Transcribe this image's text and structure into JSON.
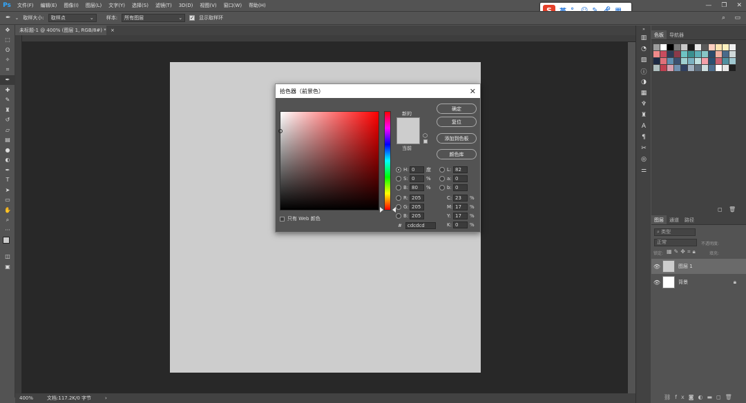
{
  "menubar": {
    "logo": "Ps",
    "items": [
      "文件(F)",
      "编辑(E)",
      "图像(I)",
      "图层(L)",
      "文字(Y)",
      "选择(S)",
      "滤镜(T)",
      "3D(D)",
      "视图(V)",
      "窗口(W)",
      "帮助(H)"
    ]
  },
  "ime": {
    "lang": "英"
  },
  "options": {
    "sample_size_label": "取样大小:",
    "sample_size_value": "取样点",
    "sample_label": "样本:",
    "sample_value": "所有图层",
    "show_ring_label": "显示取样环"
  },
  "document": {
    "tab_title": "未标题-1 @ 400% (图层 1, RGB/8#) *",
    "canvas_color": "#cdcdcd",
    "zoom": "400%",
    "doc_size": "文档:117.2K/0 字节"
  },
  "picker": {
    "title": "拾色器（前景色）",
    "new_label": "新的",
    "current_label": "当前",
    "buttons": {
      "ok": "确定",
      "reset": "复位",
      "add_to_swatches": "添加到色板",
      "color_libraries": "颜色库"
    },
    "hsb": {
      "h_label": "H:",
      "h": "0",
      "h_unit": "度",
      "s_label": "S:",
      "s": "0",
      "s_unit": "%",
      "b_label": "B:",
      "b": "80",
      "b_unit": "%"
    },
    "rgb": {
      "r_label": "R:",
      "r": "205",
      "g_label": "G:",
      "g": "205",
      "b_label": "B:",
      "b": "205"
    },
    "lab": {
      "l_label": "L:",
      "l": "82",
      "a_label": "a:",
      "a": "0",
      "b_label": "b:",
      "b": "0"
    },
    "cmyk": {
      "c_label": "C:",
      "c": "23",
      "c_unit": "%",
      "m_label": "M:",
      "m": "17",
      "m_unit": "%",
      "y_label": "Y:",
      "y": "17",
      "y_unit": "%",
      "k_label": "K:",
      "k": "0",
      "k_unit": "%"
    },
    "hex_label": "#",
    "hex": "cdcdcd",
    "web_only_label": "只有 Web 颜色",
    "new_color": "#cdcdcd",
    "current_color": "#cdcdcd"
  },
  "swatches_panel": {
    "tabs": [
      "色板",
      "导航器"
    ],
    "colors": [
      "#9e9e9e",
      "#ffffff",
      "#000000",
      "#7a7a7a",
      "#c8c8c8",
      "#1a1a1a",
      "#e8e8e8",
      "#5a5a5a",
      "#ffcfc0",
      "#ffe4b0",
      "#fff2c0",
      "#f0f0f0",
      "#f08a8a",
      "#c94c5e",
      "#2d3b56",
      "#8b3a4a",
      "#6ec3c3",
      "#3a8f8f",
      "#5eb0b8",
      "#87c6c6",
      "#2b4a6a",
      "#f2b0a0",
      "#4a6a8a",
      "#cfd8d8",
      "#1d2a44",
      "#e0707a",
      "#5f8fb0",
      "#3b5070",
      "#9fd0d0",
      "#7ab0c0",
      "#bfe0e0",
      "#f4a0a8",
      "#2a5070",
      "#c96070",
      "#5090a0",
      "#a0c8d0",
      "#b0c0c0",
      "#c04050",
      "#d8a0b0",
      "#7090b0",
      "#304060",
      "#a0b0c0",
      "#607080",
      "#d0e0e0",
      "#4f6f8f",
      "#ffffff",
      "#e8e8e8",
      "#202020"
    ]
  },
  "layers_panel": {
    "tabs": [
      "图层",
      "通道",
      "路径"
    ],
    "filter_label": "类型",
    "blend_mode": "正常",
    "opacity_label": "不透明度:",
    "lock_label": "锁定:",
    "fill_label": "填充:",
    "layers": [
      {
        "name": "图层 1",
        "thumb": "#cdcdcd"
      },
      {
        "name": "背景",
        "thumb": "#ffffff"
      }
    ]
  }
}
